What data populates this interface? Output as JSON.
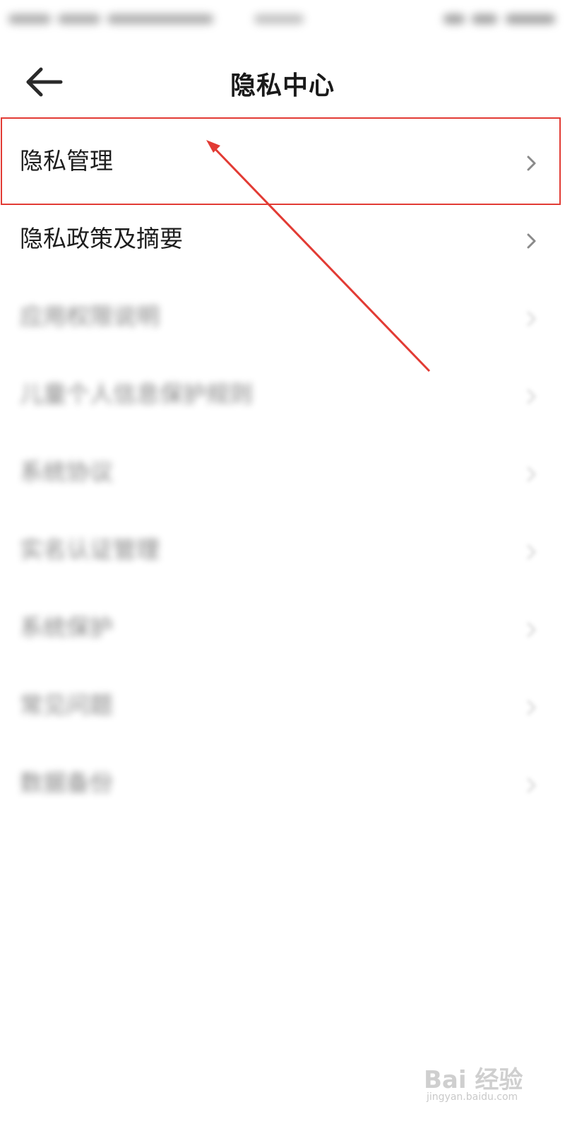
{
  "header": {
    "title": "隐私中心",
    "back_icon": "arrow-left-icon"
  },
  "menu": {
    "items": [
      {
        "label": "隐私管理",
        "highlighted": true,
        "blurred": false
      },
      {
        "label": "隐私政策及摘要",
        "highlighted": false,
        "blurred": false
      },
      {
        "label": "应用权限说明",
        "highlighted": false,
        "blurred": true
      },
      {
        "label": "儿童个人信息保护规则",
        "highlighted": false,
        "blurred": true
      },
      {
        "label": "系统协议",
        "highlighted": false,
        "blurred": true
      },
      {
        "label": "实名认证管理",
        "highlighted": false,
        "blurred": true
      },
      {
        "label": "系统保护",
        "highlighted": false,
        "blurred": true
      },
      {
        "label": "常见问题",
        "highlighted": false,
        "blurred": true
      },
      {
        "label": "数据备份",
        "highlighted": false,
        "blurred": true
      }
    ],
    "chevron_icon": "chevron-right-icon"
  },
  "annotation": {
    "color": "#e23b34"
  },
  "watermark": {
    "logo": "Bai 经验",
    "url": "jingyan.baidu.com"
  }
}
